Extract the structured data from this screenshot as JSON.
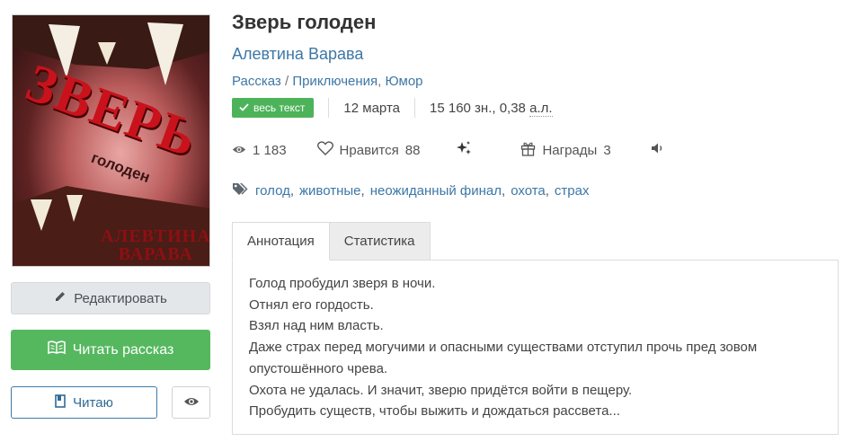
{
  "cover": {
    "title_big": "ЗВЕРЬ",
    "title_small": "голоден",
    "author_line1": "АЛЕВТИНА",
    "author_line2": "ВАРАВА"
  },
  "sidebar": {
    "edit_label": "Редактировать",
    "read_label": "Читать рассказ",
    "reading_label": "Читаю"
  },
  "book": {
    "title": "Зверь голоден",
    "author": "Алевтина Варава",
    "genres": [
      "Рассказ",
      "Приключения",
      "Юмор"
    ],
    "status_badge": "весь текст",
    "date": "12 марта",
    "size_chars": "15 160 зн., 0,38",
    "size_unit": "а.л."
  },
  "stats": {
    "views": "1 183",
    "likes_label": "Нравится",
    "likes": "88",
    "awards_label": "Награды",
    "awards": "3"
  },
  "tags": [
    "голод",
    "животные",
    "неожиданный финал",
    "охота",
    "страх"
  ],
  "tabs": [
    "Аннотация",
    "Статистика"
  ],
  "annotation": [
    "Голод пробудил зверя в ночи.",
    "Отнял его гордость.",
    "Взял над ним власть.",
    "Даже страх перед могучими и опасными существами отступил прочь пред зовом",
    "опустошённого чрева.",
    "Охота не удалась. И значит, зверю придётся войти в пещеру.",
    "Пробудить существ, чтобы выжить и дождаться рассвета..."
  ],
  "colors": {
    "link": "#3d77a6",
    "success": "#55b85f",
    "badge": "#4db35a"
  },
  "icons": [
    "pencil-icon",
    "book-open-icon",
    "bookmark-icon",
    "eye-icon",
    "heart-icon",
    "sparkles-icon",
    "gift-icon",
    "speaker-icon",
    "tag-icon",
    "check-icon"
  ]
}
